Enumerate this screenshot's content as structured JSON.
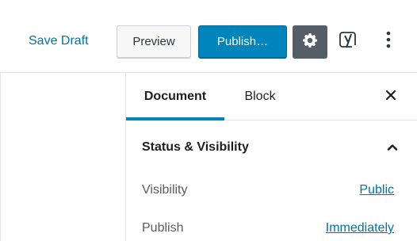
{
  "header": {
    "save_draft_label": "Save Draft",
    "preview_label": "Preview",
    "publish_label": "Publish…",
    "settings_icon": "gear-icon",
    "yoast_icon": "yoast-icon",
    "more_icon": "more-vertical-icon"
  },
  "sidebar": {
    "tabs": [
      {
        "label": "Document",
        "active": true
      },
      {
        "label": "Block",
        "active": false
      }
    ],
    "close_icon": "close-icon",
    "panel": {
      "title": "Status & Visibility",
      "expanded": true,
      "rows": [
        {
          "label": "Visibility",
          "value": "Public"
        },
        {
          "label": "Publish",
          "value": "Immediately"
        }
      ]
    }
  },
  "colors": {
    "accent": "#0085ba",
    "link": "#0073aa",
    "settings_bg": "#555d66"
  }
}
